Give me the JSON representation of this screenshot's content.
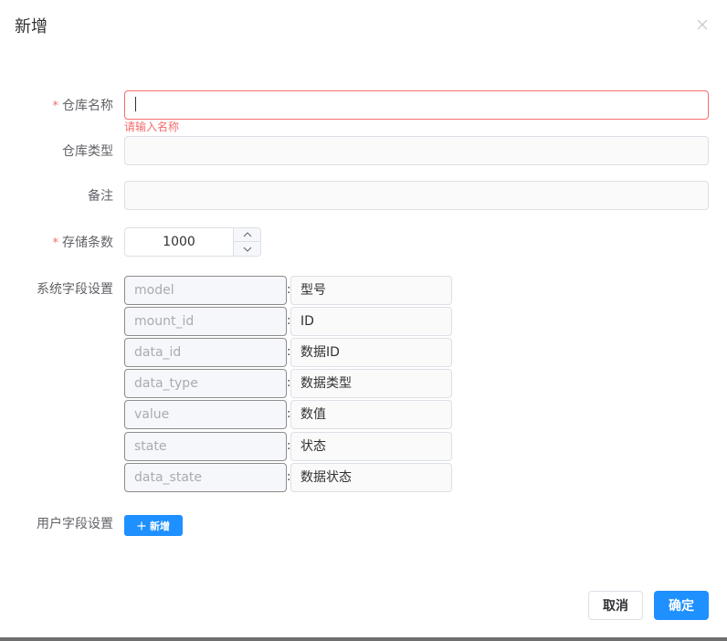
{
  "dialog": {
    "title": "新增"
  },
  "form": {
    "warehouse_name": {
      "label": "仓库名称",
      "required_mark": "*",
      "value": "",
      "error": "请输入名称"
    },
    "warehouse_type": {
      "label": "仓库类型",
      "value": ""
    },
    "remark": {
      "label": "备注",
      "value": ""
    },
    "storage_count": {
      "label": "存储条数",
      "required_mark": "*",
      "value": "1000"
    },
    "system_fields": {
      "label": "系统字段设置",
      "separator": ":",
      "rows": [
        {
          "key": "model",
          "value": "型号"
        },
        {
          "key": "mount_id",
          "value": "ID"
        },
        {
          "key": "data_id",
          "value": "数据ID"
        },
        {
          "key": "data_type",
          "value": "数据类型"
        },
        {
          "key": "value",
          "value": "数值"
        },
        {
          "key": "state",
          "value": "状态"
        },
        {
          "key": "data_state",
          "value": "数据状态"
        }
      ]
    },
    "user_fields": {
      "label": "用户字段设置",
      "add_label": "新增"
    }
  },
  "footer": {
    "cancel_label": "取消",
    "confirm_label": "确定"
  },
  "icons": {
    "close": "close-icon",
    "add": "plus-icon",
    "up": "chevron-up-icon",
    "down": "chevron-down-icon"
  },
  "colors": {
    "primary": "#1e90ff",
    "error": "#f56c6c"
  }
}
